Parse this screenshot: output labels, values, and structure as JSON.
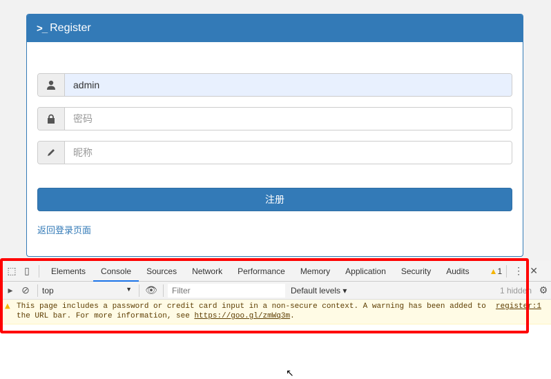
{
  "register": {
    "title": "Register",
    "title_icon": "terminal-icon",
    "username_value": "admin",
    "password_placeholder": "密码",
    "nickname_placeholder": "昵称",
    "submit_label": "注册",
    "back_link": "返回登录页面"
  },
  "devtools": {
    "tabs": [
      "Elements",
      "Console",
      "Sources",
      "Network",
      "Performance",
      "Memory",
      "Application",
      "Security",
      "Audits"
    ],
    "active_tab": "Console",
    "warning_count": "1",
    "context": "top",
    "filter_placeholder": "Filter",
    "levels": "Default levels ▾",
    "hidden": "1 hidden",
    "message": {
      "text1": "This page includes a password or credit card input in a non-secure context. A warning has been added to",
      "text2": "the URL bar. For more information, see ",
      "link": "https://goo.gl/zmWq3m",
      "text3": ".",
      "source": "register:1"
    }
  },
  "colors": {
    "primary": "#337ab7",
    "highlight": "#ff0000",
    "warning_bg": "#fffbe5"
  }
}
